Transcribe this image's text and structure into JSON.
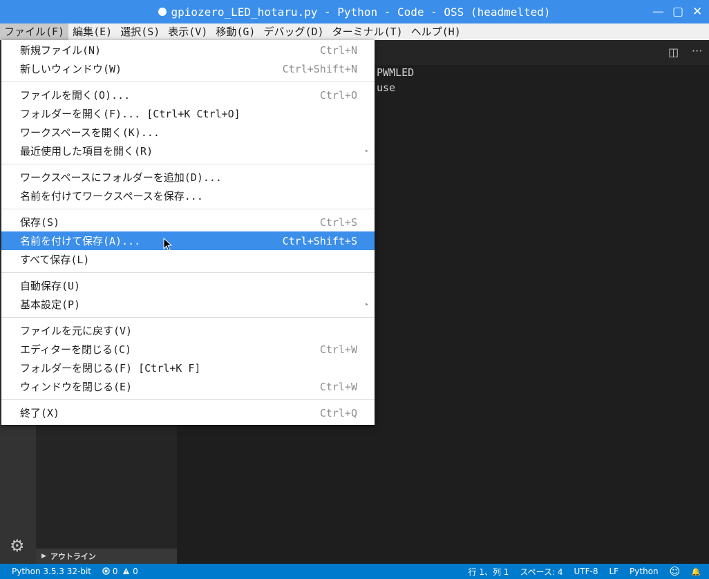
{
  "window": {
    "title": "gpiozero_LED_hotaru.py - Python - Code - OSS (headmelted)",
    "controls": {
      "minimize": "—",
      "maximize": "▢",
      "close": "✕"
    }
  },
  "menubar": {
    "items": [
      "ファイル(F)",
      "編集(E)",
      "選択(S)",
      "表示(V)",
      "移動(G)",
      "デバッグ(D)",
      "ターミナル(T)",
      "ヘルプ(H)"
    ]
  },
  "file_menu": {
    "groups": [
      [
        {
          "label": "新規ファイル(N)",
          "shortcut": "Ctrl+N"
        },
        {
          "label": "新しいウィンドウ(W)",
          "shortcut": "Ctrl+Shift+N"
        }
      ],
      [
        {
          "label": "ファイルを開く(O)...",
          "shortcut": "Ctrl+O"
        },
        {
          "label": "フォルダーを開く(F)... [Ctrl+K Ctrl+O]",
          "shortcut": ""
        },
        {
          "label": "ワークスペースを開く(K)...",
          "shortcut": ""
        },
        {
          "label": "最近使用した項目を開く(R)",
          "shortcut": "",
          "submenu": true
        }
      ],
      [
        {
          "label": "ワークスペースにフォルダーを追加(D)...",
          "shortcut": ""
        },
        {
          "label": "名前を付けてワークスペースを保存...",
          "shortcut": ""
        }
      ],
      [
        {
          "label": "保存(S)",
          "shortcut": "Ctrl+S"
        },
        {
          "label": "名前を付けて保存(A)...",
          "shortcut": "Ctrl+Shift+S",
          "highlighted": true
        },
        {
          "label": "すべて保存(L)",
          "shortcut": ""
        }
      ],
      [
        {
          "label": "自動保存(U)",
          "shortcut": ""
        },
        {
          "label": "基本設定(P)",
          "shortcut": "",
          "submenu": true
        }
      ],
      [
        {
          "label": "ファイルを元に戻す(V)",
          "shortcut": ""
        },
        {
          "label": "エディターを閉じる(C)",
          "shortcut": "Ctrl+W"
        },
        {
          "label": "フォルダーを閉じる(F) [Ctrl+K F]",
          "shortcut": ""
        },
        {
          "label": "ウィンドウを閉じる(E)",
          "shortcut": "Ctrl+W"
        }
      ],
      [
        {
          "label": "終了(X)",
          "shortcut": "Ctrl+Q"
        }
      ]
    ],
    "submenu_arrow": "▸"
  },
  "editor": {
    "code_lines": [
      "PWMLED",
      "use"
    ],
    "actions": {
      "split": "◫",
      "more": "···"
    }
  },
  "sidebar": {
    "outline_label": "アウトライン",
    "outline_chevron": "▶"
  },
  "activitybar": {
    "settings_icon": "⚙"
  },
  "statusbar": {
    "interpreter": "Python 3.5.3 32-bit",
    "errors": "0",
    "warnings": "0",
    "position": "行 1、列 1",
    "indent": "スペース: 4",
    "encoding": "UTF-8",
    "eol": "LF",
    "language": "Python",
    "smiley": "☺",
    "bell": "🔔"
  },
  "colors": {
    "accent": "#3b8eea",
    "statusbar": "#007acc",
    "editor_bg": "#1e1e1e"
  }
}
